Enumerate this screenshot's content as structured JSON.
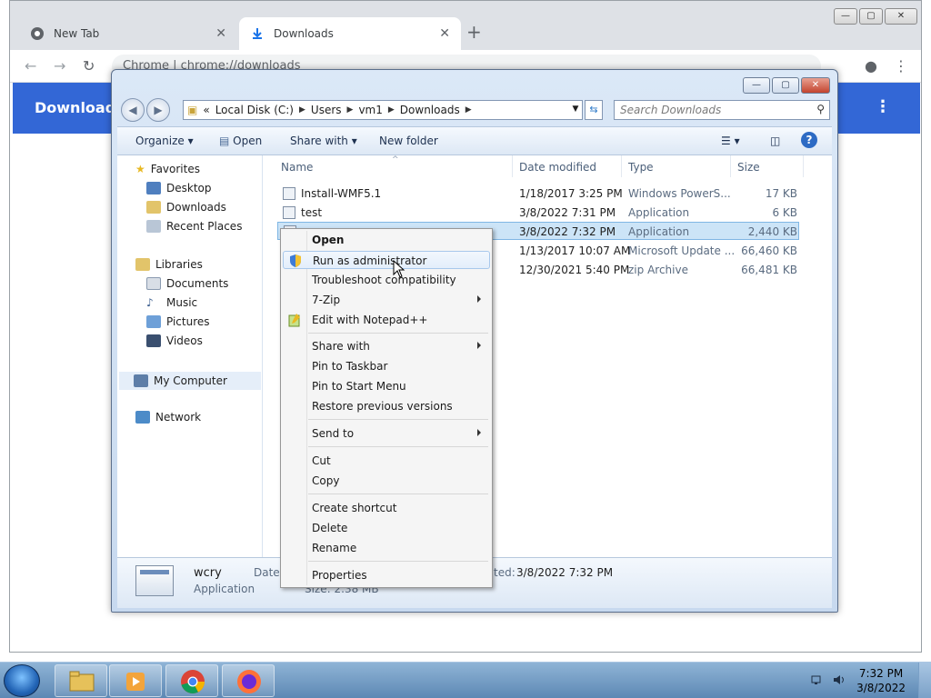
{
  "chrome": {
    "tabs": [
      {
        "label": "New Tab"
      },
      {
        "label": "Downloads"
      }
    ],
    "close_glyph": "✕",
    "new_tab_glyph": "+",
    "url": "Chrome  |  chrome://downloads",
    "page_title": "Downloads",
    "window_buttons": {
      "minimize": "—",
      "maximize": "▢",
      "close": "✕"
    }
  },
  "explorer": {
    "window_buttons": {
      "minimize": "—",
      "maximize": "▢",
      "close": "✕"
    },
    "breadcrumbs": [
      "Local Disk (C:)",
      "Users",
      "vm1",
      "Downloads"
    ],
    "breadcrumb_prefix": "«",
    "search_placeholder": "Search Downloads",
    "toolbar": {
      "organize": "Organize ▾",
      "open": "Open",
      "share_with": "Share with ▾",
      "new_folder": "New folder"
    },
    "nav": {
      "favorites": "Favorites",
      "desktop": "Desktop",
      "downloads": "Downloads",
      "recent_places": "Recent Places",
      "libraries": "Libraries",
      "documents": "Documents",
      "music": "Music",
      "pictures": "Pictures",
      "videos": "Videos",
      "my_computer": "My Computer",
      "network": "Network"
    },
    "columns": {
      "name": "Name",
      "date": "Date modified",
      "type": "Type",
      "size": "Size"
    },
    "files": [
      {
        "name": "Install-WMF5.1",
        "date": "1/18/2017 3:25 PM",
        "type": "Windows PowerS...",
        "size": "17 KB"
      },
      {
        "name": "test",
        "date": "3/8/2022 7:31 PM",
        "type": "Application",
        "size": "6 KB"
      },
      {
        "name": "",
        "date": "3/8/2022 7:32 PM",
        "type": "Application",
        "size": "2,440 KB"
      },
      {
        "name": "",
        "date": "1/13/2017 10:07 AM",
        "type": "Microsoft Update ...",
        "size": "66,460 KB"
      },
      {
        "name": "",
        "date": "12/30/2021 5:40 PM",
        "type": "zip Archive",
        "size": "66,481 KB"
      }
    ],
    "details": {
      "name": "wcry",
      "type": "Application",
      "date_label": "Date m",
      "created_label": "ted:",
      "created_value": "3/8/2022 7:32 PM",
      "size_label": "Size: 2.38 MB"
    }
  },
  "context_menu": {
    "items": [
      {
        "label": "Open"
      },
      {
        "label": "Run as administrator"
      },
      {
        "label": "Troubleshoot compatibility"
      },
      {
        "label": "7-Zip"
      },
      {
        "label": "Edit with Notepad++"
      },
      {
        "label": "Share with"
      },
      {
        "label": "Pin to Taskbar"
      },
      {
        "label": "Pin to Start Menu"
      },
      {
        "label": "Restore previous versions"
      },
      {
        "label": "Send to"
      },
      {
        "label": "Cut"
      },
      {
        "label": "Copy"
      },
      {
        "label": "Create shortcut"
      },
      {
        "label": "Delete"
      },
      {
        "label": "Rename"
      },
      {
        "label": "Properties"
      }
    ]
  },
  "taskbar": {
    "time": "7:32 PM",
    "date": "3/8/2022"
  }
}
